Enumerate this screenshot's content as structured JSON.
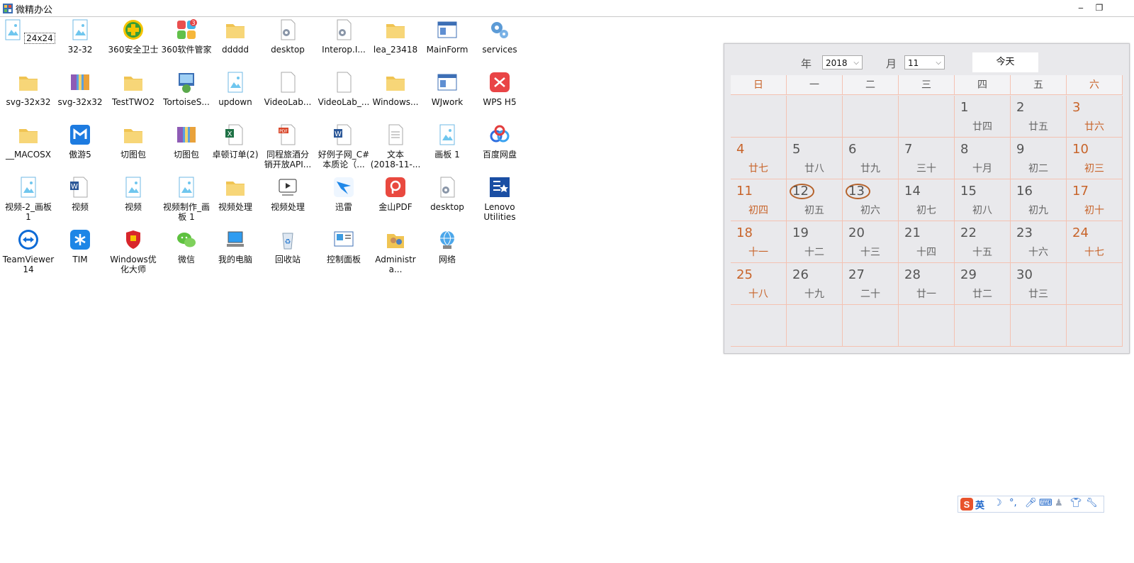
{
  "window": {
    "title": "微精办公",
    "min": "‒",
    "restore": "❐"
  },
  "desktop": {
    "icons": [
      {
        "label": "24x24",
        "kind": "image",
        "selected": true
      },
      {
        "label": "32-32",
        "kind": "image"
      },
      {
        "label": "360安全卫士",
        "kind": "360safe"
      },
      {
        "label": "360软件管家",
        "kind": "360soft"
      },
      {
        "label": "ddddd",
        "kind": "folder"
      },
      {
        "label": "desktop",
        "kind": "gearfile"
      },
      {
        "label": "Interop.I...",
        "kind": "gearfile"
      },
      {
        "label": "lea_23418",
        "kind": "folder"
      },
      {
        "label": "MainForm",
        "kind": "window"
      },
      {
        "label": "services",
        "kind": "gears"
      },
      {
        "label": "svg-32x32",
        "kind": "folder"
      },
      {
        "label": "svg-32x32",
        "kind": "archive"
      },
      {
        "label": "TestTWO2",
        "kind": "folder"
      },
      {
        "label": "TortoiseS...",
        "kind": "installer"
      },
      {
        "label": "updown",
        "kind": "image"
      },
      {
        "label": "VideoLab...",
        "kind": "file"
      },
      {
        "label": "VideoLab_...",
        "kind": "file"
      },
      {
        "label": "Windows...",
        "kind": "folder"
      },
      {
        "label": "WJwork",
        "kind": "window"
      },
      {
        "label": "WPS H5",
        "kind": "wps"
      },
      {
        "label": "__MACOSX",
        "kind": "folder"
      },
      {
        "label": "傲游5",
        "kind": "maxthon"
      },
      {
        "label": "切图包",
        "kind": "folder"
      },
      {
        "label": "切图包",
        "kind": "archive"
      },
      {
        "label": "卓顿订单(2)",
        "kind": "excel"
      },
      {
        "label": "同程旅酒分\n销开放API...",
        "kind": "pdf"
      },
      {
        "label": "好例子网_C#\n本质论（...",
        "kind": "word"
      },
      {
        "label": "文本\n(2018-11-...",
        "kind": "text"
      },
      {
        "label": "画板 1",
        "kind": "image"
      },
      {
        "label": "百度网盘",
        "kind": "baidu"
      },
      {
        "label": "视频-2_画板\n1",
        "kind": "image"
      },
      {
        "label": "视频",
        "kind": "word"
      },
      {
        "label": "视频",
        "kind": "image"
      },
      {
        "label": "视频制作_画\n板 1",
        "kind": "image"
      },
      {
        "label": "视频处理",
        "kind": "folder"
      },
      {
        "label": "视频处理",
        "kind": "video"
      },
      {
        "label": "迅雷",
        "kind": "xunlei"
      },
      {
        "label": "金山PDF",
        "kind": "kpdf"
      },
      {
        "label": "desktop",
        "kind": "gearfile"
      },
      {
        "label": "Lenovo\nUtilities",
        "kind": "lenovo"
      },
      {
        "label": "TeamViewer\n14",
        "kind": "teamviewer"
      },
      {
        "label": "TIM",
        "kind": "tim"
      },
      {
        "label": "Windows优\n化大师",
        "kind": "winopt"
      },
      {
        "label": "微信",
        "kind": "wechat"
      },
      {
        "label": "我的电脑",
        "kind": "computer"
      },
      {
        "label": "回收站",
        "kind": "recycle"
      },
      {
        "label": "控制面板",
        "kind": "control"
      },
      {
        "label": "Administra...",
        "kind": "users"
      },
      {
        "label": "网络",
        "kind": "network"
      }
    ]
  },
  "calendar": {
    "year_label": "年",
    "year_value": "2018",
    "month_label": "月",
    "month_value": "11",
    "today_button": "今天",
    "weekdays": [
      "日",
      "一",
      "二",
      "三",
      "四",
      "五",
      "六"
    ],
    "rows": [
      [
        {
          "d": "",
          "l": ""
        },
        {
          "d": "",
          "l": ""
        },
        {
          "d": "",
          "l": ""
        },
        {
          "d": "",
          "l": ""
        },
        {
          "d": "1",
          "l": "廿四"
        },
        {
          "d": "2",
          "l": "廿五"
        },
        {
          "d": "3",
          "l": "廿六"
        }
      ],
      [
        {
          "d": "4",
          "l": "廿七"
        },
        {
          "d": "5",
          "l": "廿八"
        },
        {
          "d": "6",
          "l": "廿九"
        },
        {
          "d": "7",
          "l": "三十"
        },
        {
          "d": "8",
          "l": "十月"
        },
        {
          "d": "9",
          "l": "初二"
        },
        {
          "d": "10",
          "l": "初三"
        }
      ],
      [
        {
          "d": "11",
          "l": "初四"
        },
        {
          "d": "12",
          "l": "初五",
          "ring": true
        },
        {
          "d": "13",
          "l": "初六",
          "ring": true
        },
        {
          "d": "14",
          "l": "初七"
        },
        {
          "d": "15",
          "l": "初八"
        },
        {
          "d": "16",
          "l": "初九"
        },
        {
          "d": "17",
          "l": "初十"
        }
      ],
      [
        {
          "d": "18",
          "l": "十一"
        },
        {
          "d": "19",
          "l": "十二"
        },
        {
          "d": "20",
          "l": "十三"
        },
        {
          "d": "21",
          "l": "十四"
        },
        {
          "d": "22",
          "l": "十五"
        },
        {
          "d": "23",
          "l": "十六"
        },
        {
          "d": "24",
          "l": "十七"
        }
      ],
      [
        {
          "d": "25",
          "l": "十八"
        },
        {
          "d": "26",
          "l": "十九"
        },
        {
          "d": "27",
          "l": "二十"
        },
        {
          "d": "28",
          "l": "廿一"
        },
        {
          "d": "29",
          "l": "廿二"
        },
        {
          "d": "30",
          "l": "廿三"
        },
        {
          "d": "",
          "l": ""
        }
      ],
      [
        {
          "d": "",
          "l": ""
        },
        {
          "d": "",
          "l": ""
        },
        {
          "d": "",
          "l": ""
        },
        {
          "d": "",
          "l": ""
        },
        {
          "d": "",
          "l": ""
        },
        {
          "d": "",
          "l": ""
        },
        {
          "d": "",
          "l": ""
        }
      ]
    ]
  },
  "ime": {
    "logo": "S",
    "mode": "英",
    "icons": [
      "moon-icon",
      "punctuation-icon",
      "mic-icon",
      "keyboard-icon",
      "user-icon",
      "skin-icon",
      "tools-icon"
    ]
  }
}
